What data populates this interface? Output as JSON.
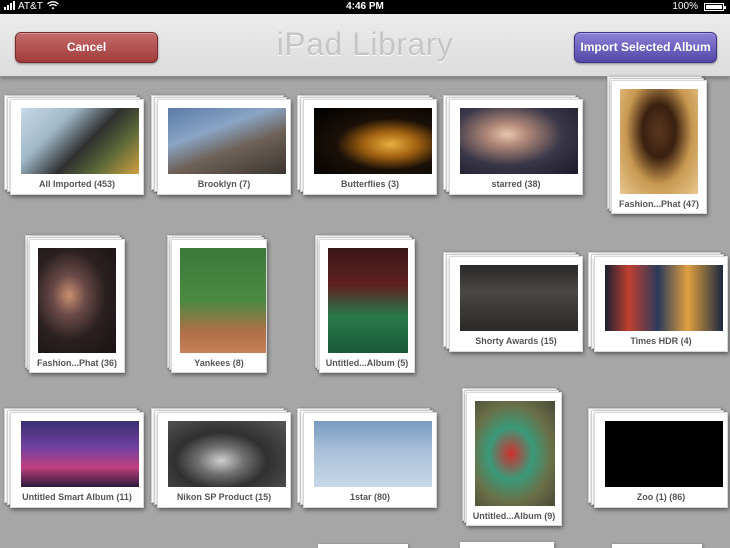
{
  "status_bar": {
    "carrier": "AT&T",
    "time": "4:46 PM",
    "battery": "100%"
  },
  "header": {
    "title": "iPad Library",
    "cancel_label": "Cancel",
    "import_label": "Import Selected Album"
  },
  "albums": [
    {
      "label": "All Imported (453)"
    },
    {
      "label": "Brooklyn (7)"
    },
    {
      "label": "Butterflies (3)"
    },
    {
      "label": "starred (38)"
    },
    {
      "label": "Fashion...Phat (47)"
    },
    {
      "label": "Fashion...Phat (36)"
    },
    {
      "label": "Yankees (8)"
    },
    {
      "label": "Untitled...Album (5)"
    },
    {
      "label": "Shorty Awards (15)"
    },
    {
      "label": "Times HDR (4)"
    },
    {
      "label": "Untitled Smart Album (11)"
    },
    {
      "label": "Nikon SP Product (15)"
    },
    {
      "label": "1star (80)"
    },
    {
      "label": "Untitled...Album (9)"
    },
    {
      "label": "Zoo (1) (86)"
    }
  ]
}
